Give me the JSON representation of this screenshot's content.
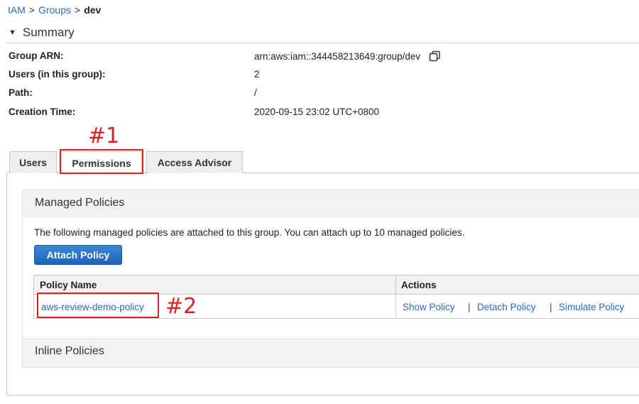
{
  "breadcrumb": {
    "items": [
      "IAM",
      "Groups"
    ],
    "separator": ">",
    "current": "dev"
  },
  "summary": {
    "title": "Summary",
    "rows": [
      {
        "label": "Group ARN:",
        "value": "arn:aws:iam::344458213649:group/dev"
      },
      {
        "label": "Users (in this group):",
        "value": "2"
      },
      {
        "label": "Path:",
        "value": "/"
      },
      {
        "label": "Creation Time:",
        "value": "2020-09-15 23:02 UTC+0800"
      }
    ]
  },
  "annotations": {
    "tab_marker": "#1",
    "policy_marker": "#2",
    "color": "#e02020"
  },
  "tabs": [
    {
      "label": "Users",
      "active": false
    },
    {
      "label": "Permissions",
      "active": true
    },
    {
      "label": "Access Advisor",
      "active": false
    }
  ],
  "managed_policies": {
    "title": "Managed Policies",
    "description": "The following managed policies are attached to this group. You can attach up to 10 managed policies.",
    "attach_button": "Attach Policy",
    "columns": [
      "Policy Name",
      "Actions"
    ],
    "rows": [
      {
        "policy_name": "aws-review-demo-policy",
        "actions": [
          "Show Policy",
          "Detach Policy",
          "Simulate Policy"
        ]
      }
    ],
    "action_separator": "|"
  },
  "inline_policies": {
    "title": "Inline Policies"
  },
  "colors": {
    "link": "#2b6bb8",
    "primary_button": "#1f63b8",
    "annotation": "#e02020"
  }
}
